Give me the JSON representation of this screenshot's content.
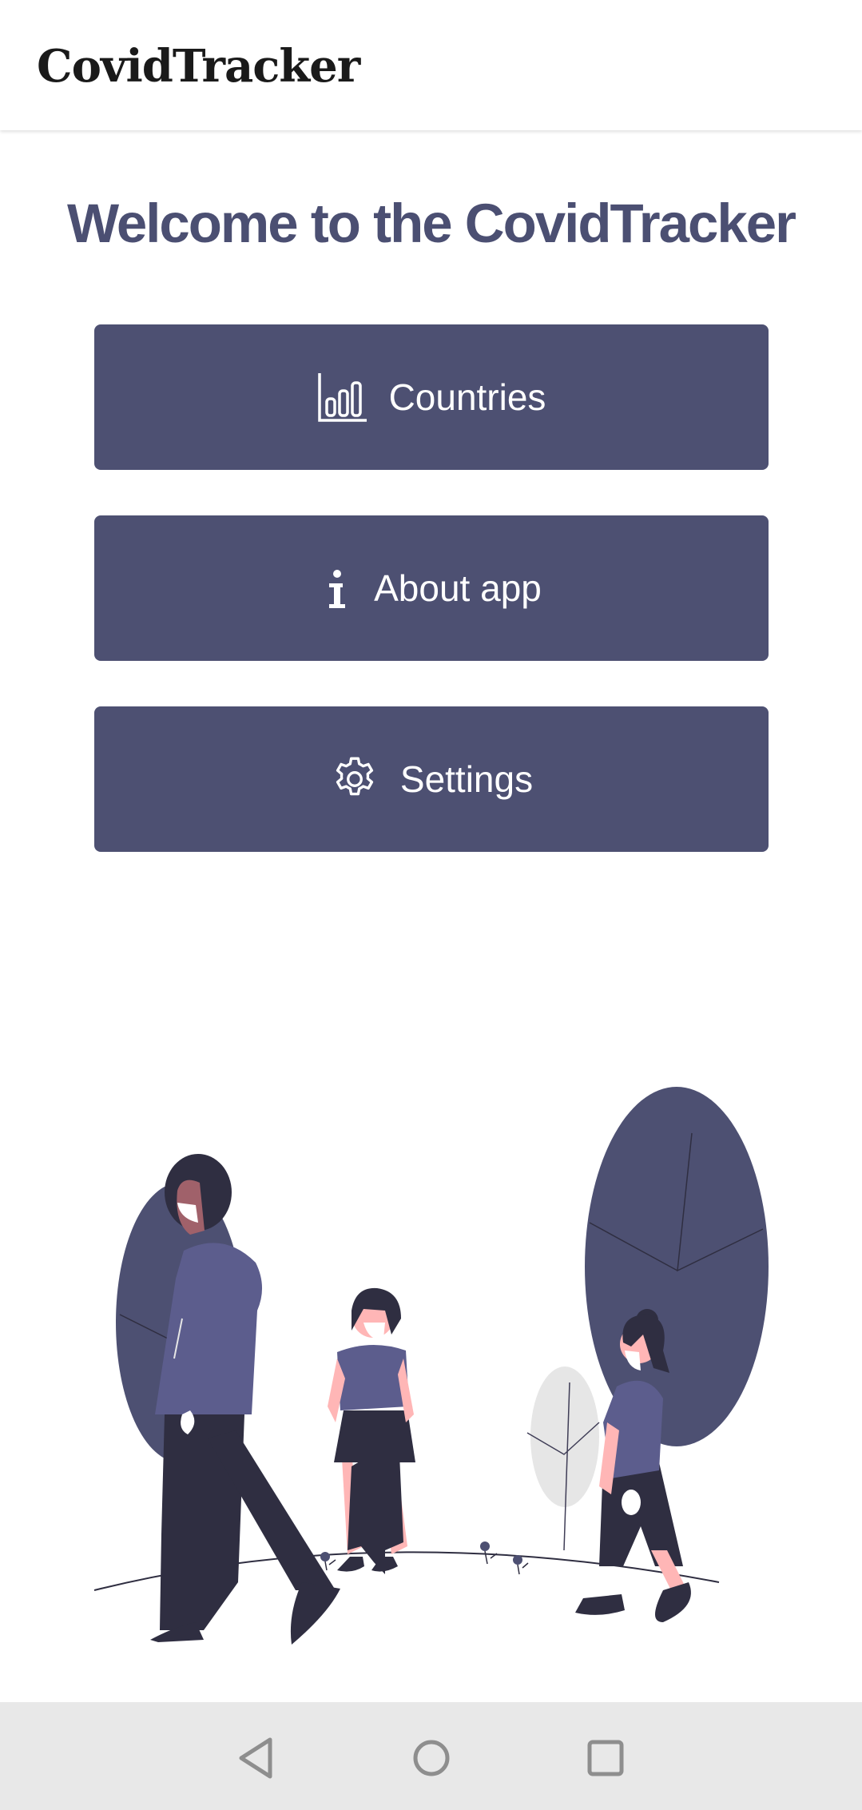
{
  "app_bar": {
    "title": "CovidTracker"
  },
  "main": {
    "welcome_text": "Welcome to the CovidTracker",
    "buttons": [
      {
        "label": "Countries",
        "icon": "bar-chart-icon"
      },
      {
        "label": "About app",
        "icon": "info-icon"
      },
      {
        "label": "Settings",
        "icon": "gear-icon"
      }
    ]
  },
  "illustration": {
    "description_icon": "people-walking-with-masks-illustration"
  },
  "nav_bar": {
    "back": "back-triangle-icon",
    "home": "home-circle-icon",
    "recents": "recents-square-icon"
  },
  "colors": {
    "primary": "#4d5072",
    "title_text": "#4b4f72",
    "skin": "#ffb6b6",
    "dark": "#2f2e41",
    "nav_bg": "#e8e8e8"
  }
}
